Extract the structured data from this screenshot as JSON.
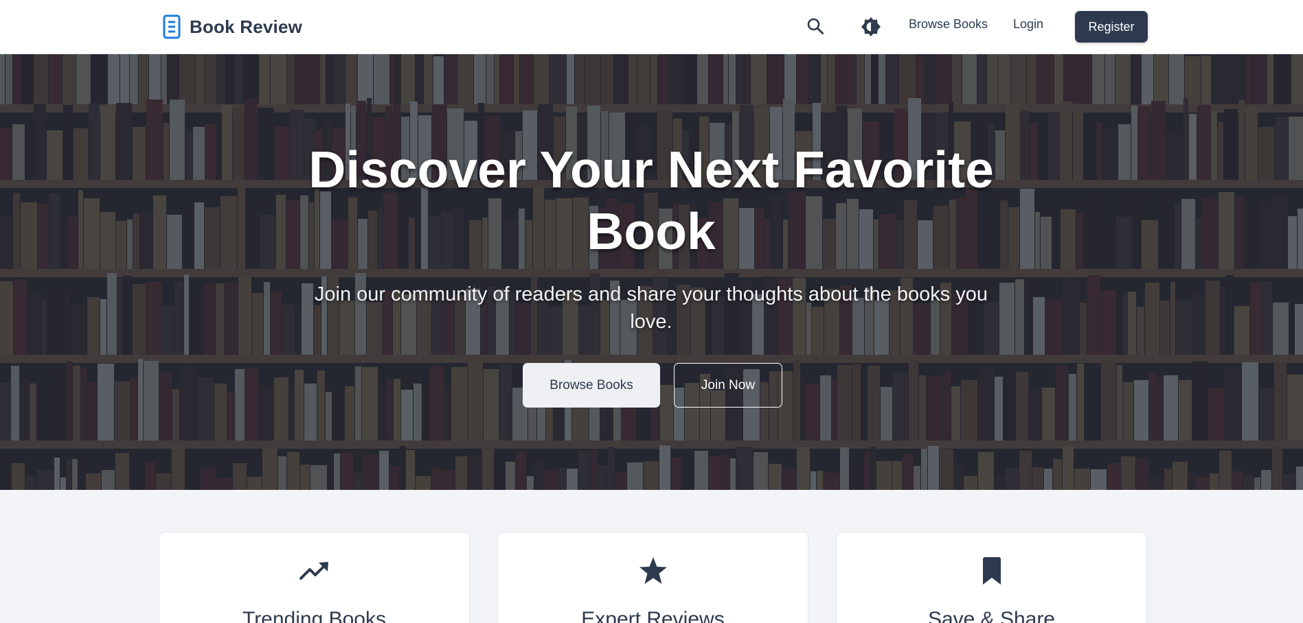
{
  "header": {
    "brand": {
      "label": "Book Review",
      "icon": "document-icon"
    },
    "search_icon": "search-icon",
    "theme_icon": "brightness-icon",
    "nav": {
      "browse_label": "Browse Books",
      "login_label": "Login",
      "register_label": "Register"
    }
  },
  "hero": {
    "title": "Discover Your Next Favorite Book",
    "subtitle": "Join our community of readers and share your thoughts about the books you love.",
    "browse_label": "Browse Books",
    "join_label": "Join Now"
  },
  "features": [
    {
      "icon": "trending-up-icon",
      "title": "Trending Books"
    },
    {
      "icon": "star-icon",
      "title": "Expert Reviews"
    },
    {
      "icon": "bookmark-icon",
      "title": "Save & Share"
    }
  ],
  "colors": {
    "primary": "#2d3a4e",
    "accent": "#1f7ae0",
    "page_background": "#f3f4f7"
  }
}
